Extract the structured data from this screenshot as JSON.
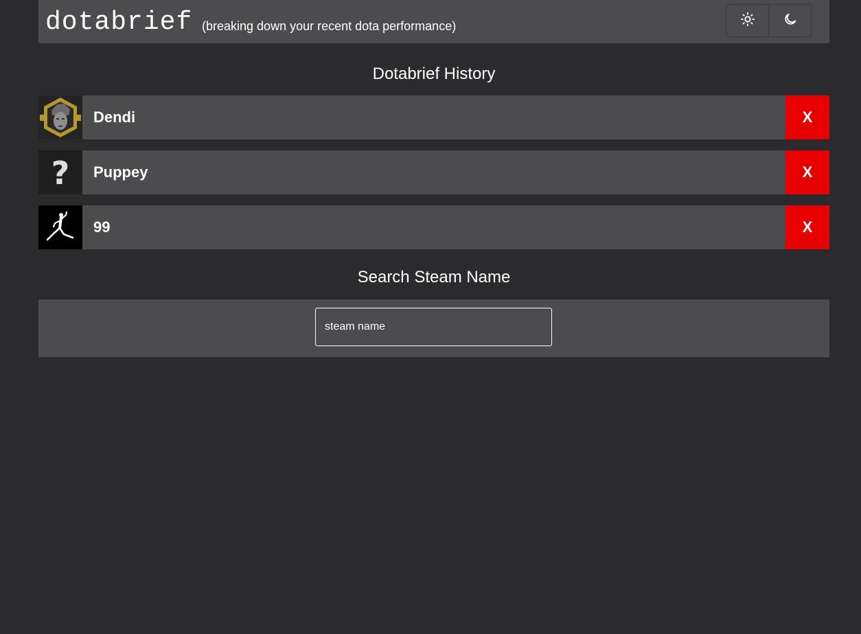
{
  "header": {
    "logo": "dotabrief",
    "tagline": "(breaking down your recent dota performance)",
    "theme_buttons": [
      {
        "icon": "sun-icon",
        "mode": "light"
      },
      {
        "icon": "moon-icon",
        "mode": "dark"
      }
    ]
  },
  "history": {
    "title": "Dotabrief History",
    "items": [
      {
        "name": "Dendi",
        "avatar": "dendi-portrait-avatar",
        "remove_label": "X"
      },
      {
        "name": "Puppey",
        "avatar": "question-mark-avatar",
        "remove_label": "X"
      },
      {
        "name": "99",
        "avatar": "jumpman-logo-avatar",
        "remove_label": "X"
      }
    ]
  },
  "search": {
    "title": "Search Steam Name",
    "placeholder": "steam name",
    "value": ""
  },
  "colors": {
    "background": "#2b2b2d",
    "panel": "#4c4b4e",
    "remove_button": "#e60000",
    "text": "#ffffff"
  }
}
